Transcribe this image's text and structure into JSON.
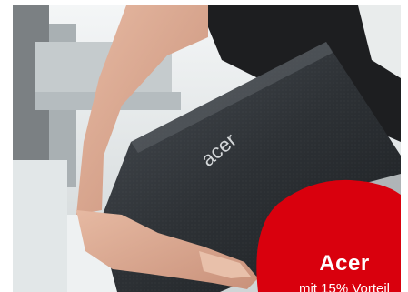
{
  "promo": {
    "brand": "Acer",
    "offer": "mit 15% Vorteil"
  },
  "colors": {
    "badge": "#d9000d",
    "laptop": "#2b2f33",
    "skin": "#d7a58d"
  },
  "image": {
    "laptop_logo_text": "acer"
  }
}
